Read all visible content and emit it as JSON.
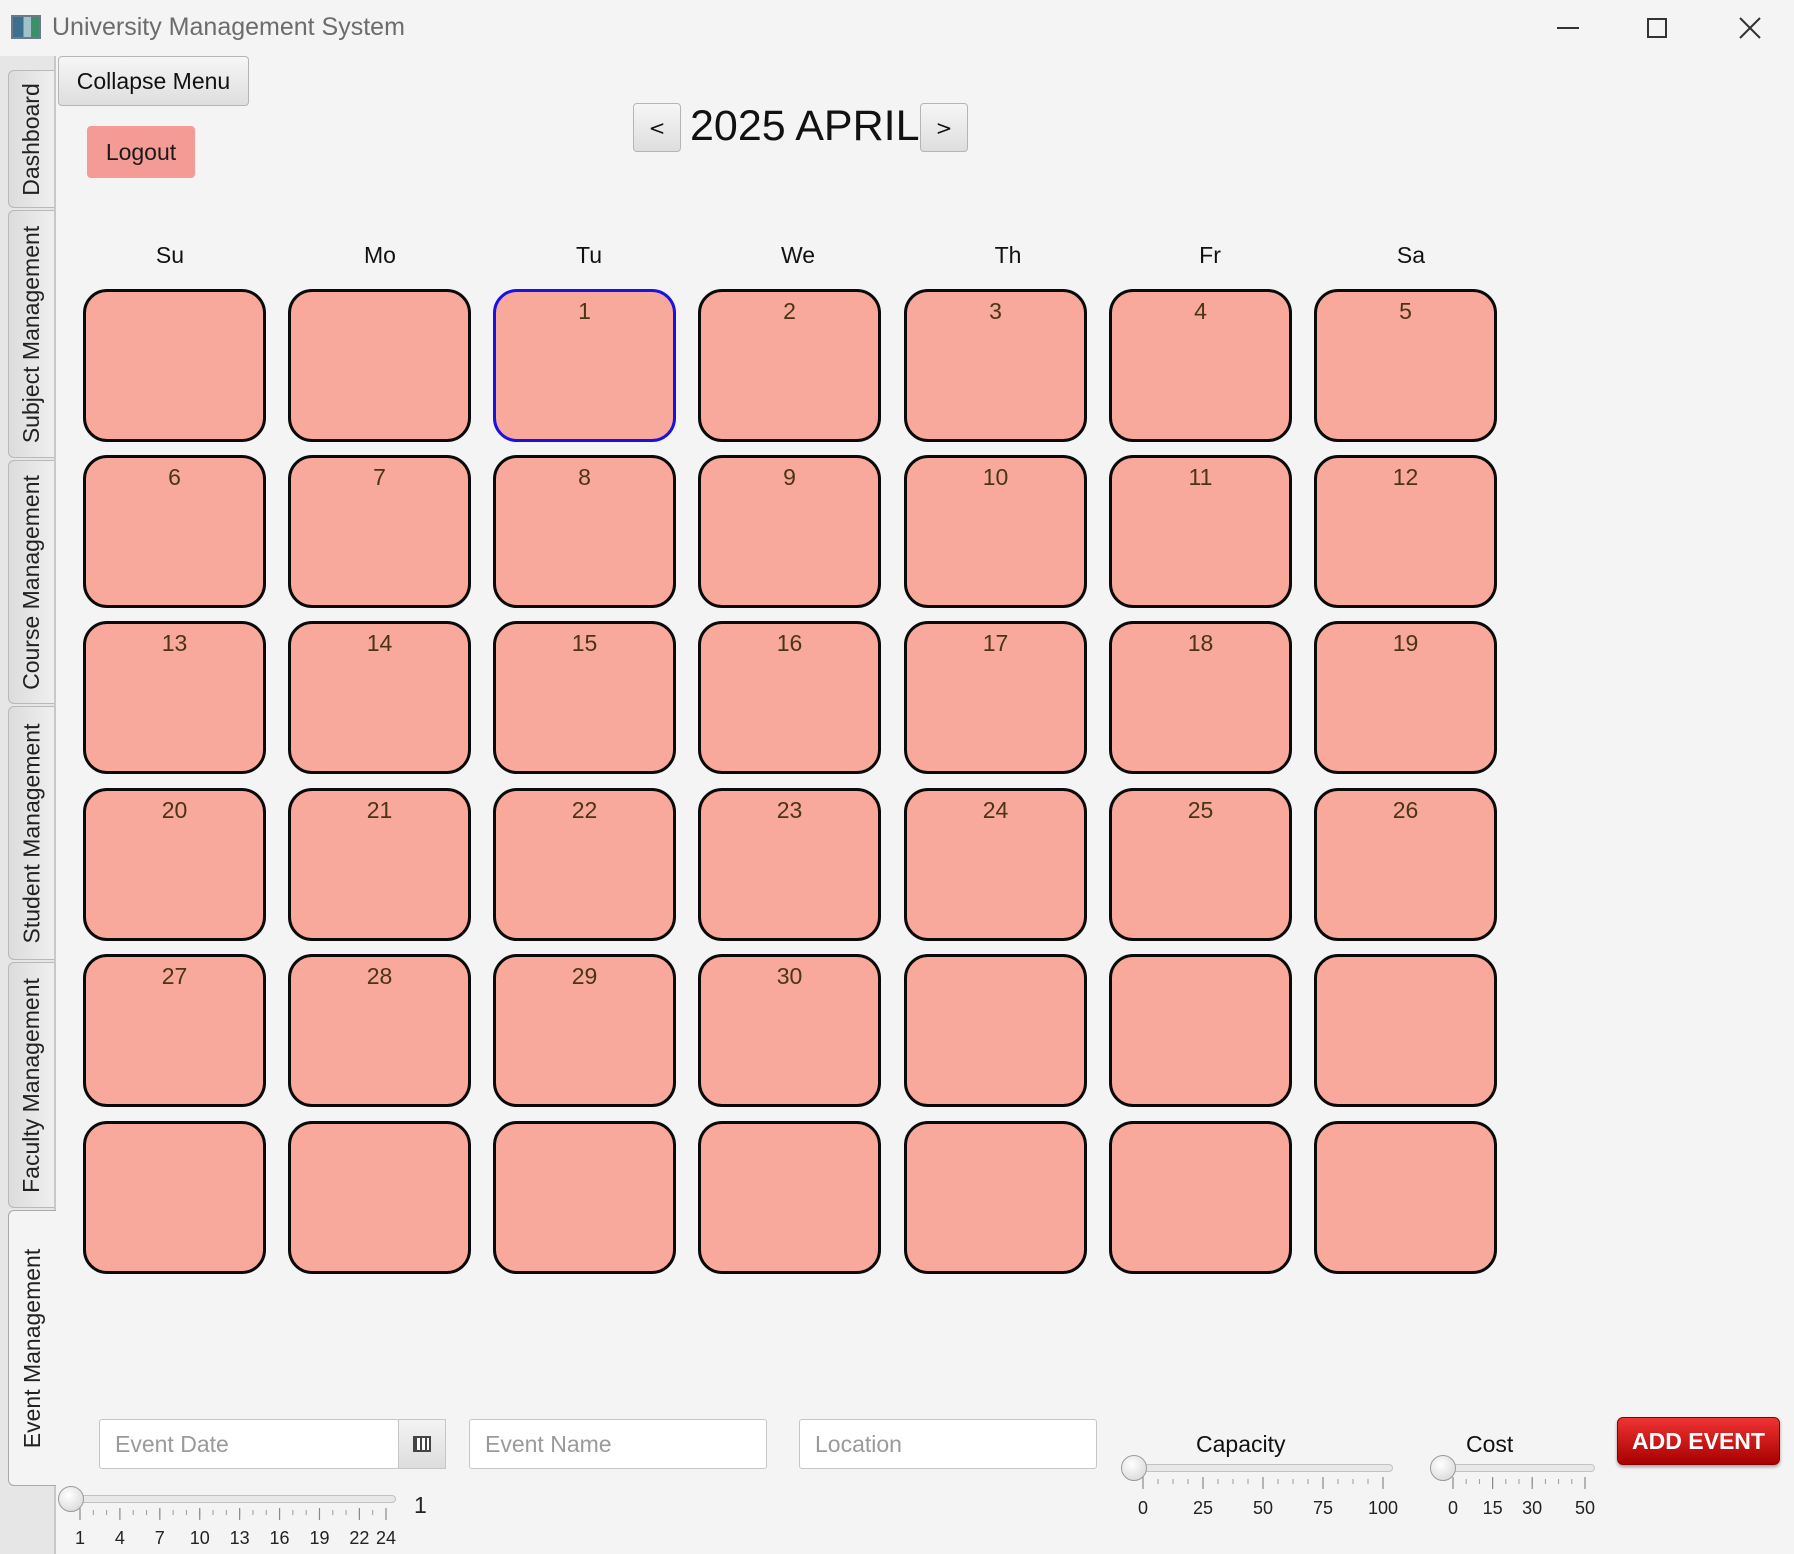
{
  "window": {
    "title": "University Management System",
    "minimize_label": "",
    "maximize_label": "",
    "close_label": ""
  },
  "tabs": [
    {
      "label": "Dashboard"
    },
    {
      "label": "Subject Management"
    },
    {
      "label": "Course Management"
    },
    {
      "label": "Student Management"
    },
    {
      "label": "Faculty Management"
    },
    {
      "label": "Event Management",
      "active": true
    }
  ],
  "toolbar": {
    "collapse_label": "Collapse Menu",
    "logout_label": "Logout"
  },
  "calendar": {
    "prev_label": "<",
    "next_label": ">",
    "month_title": "2025 APRIL",
    "weekdays": [
      "Su",
      "Mo",
      "Tu",
      "We",
      "Th",
      "Fr",
      "Sa"
    ],
    "selected_day": "1",
    "days": [
      "",
      "",
      "1",
      "2",
      "3",
      "4",
      "5",
      "6",
      "7",
      "8",
      "9",
      "10",
      "11",
      "12",
      "13",
      "14",
      "15",
      "16",
      "17",
      "18",
      "19",
      "20",
      "21",
      "22",
      "23",
      "24",
      "25",
      "26",
      "27",
      "28",
      "29",
      "30",
      "",
      "",
      "",
      "",
      "",
      "",
      "",
      "",
      "",
      ""
    ]
  },
  "form": {
    "event_date_placeholder": "Event Date",
    "calendar_icon": "calendar-icon",
    "event_name_placeholder": "Event Name",
    "location_placeholder": "Location",
    "duration_slider": {
      "value": "1",
      "min": 1,
      "max": 24,
      "tick_labels": [
        "1",
        "4",
        "7",
        "10",
        "13",
        "16",
        "19",
        "22",
        "24"
      ]
    },
    "capacity_slider": {
      "label": "Capacity",
      "value": 0,
      "min": 0,
      "max": 100,
      "tick_labels": [
        "0",
        "25",
        "50",
        "75",
        "100"
      ]
    },
    "cost_slider": {
      "label": "Cost",
      "value": 0,
      "min": 0,
      "max": 50,
      "tick_labels": [
        "0",
        "15",
        "30",
        "50"
      ]
    },
    "add_event_label": "ADD EVENT"
  },
  "colors": {
    "cell_fill": "#f9a99c",
    "cell_border": "#0a0a0a",
    "selected_border": "#1a12e0",
    "logout_bg": "#f59b96",
    "add_event_bg": "#d01010"
  }
}
